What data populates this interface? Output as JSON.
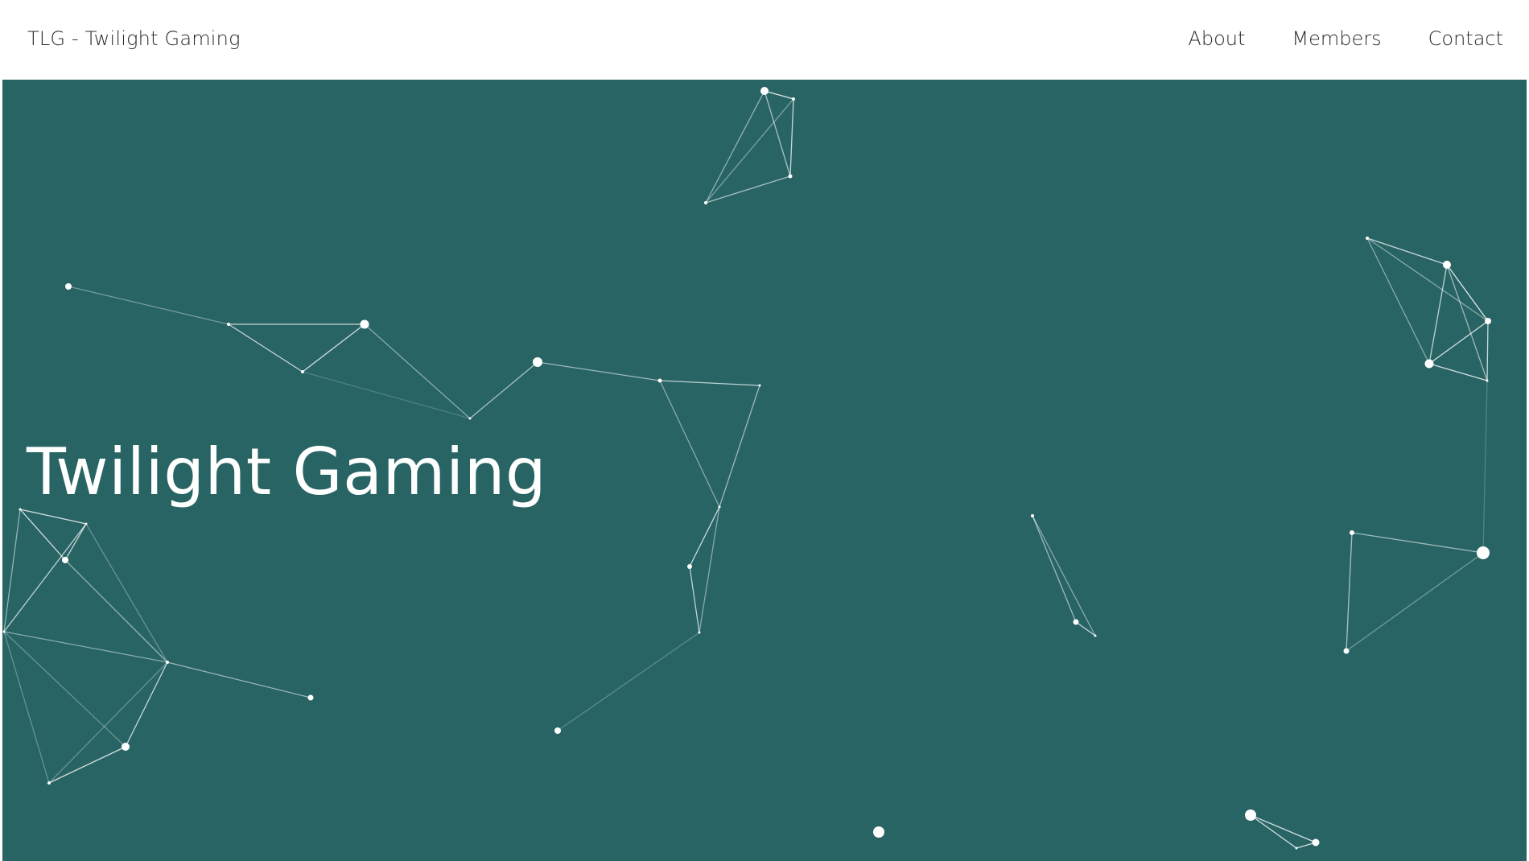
{
  "header": {
    "brand": "TLG - Twilight Gaming",
    "nav": [
      {
        "label": "About"
      },
      {
        "label": "Members"
      },
      {
        "label": "Contact"
      }
    ]
  },
  "hero": {
    "title": "Twilight Gaming",
    "background_color": "#286464",
    "accent_color": "#ffffff"
  }
}
